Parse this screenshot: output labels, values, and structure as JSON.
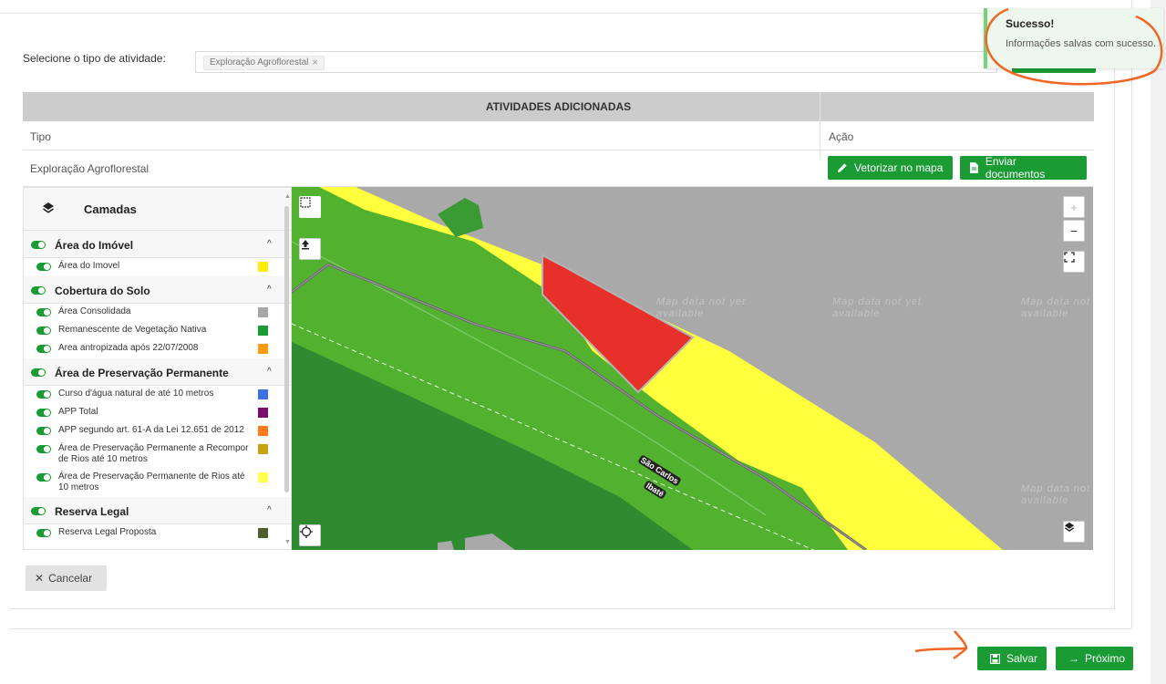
{
  "activity": {
    "label": "Selecione o tipo de atividade:",
    "selected_chip": "Exploração Agroflorestal",
    "chip_remove": "×"
  },
  "toast": {
    "title": "Sucesso!",
    "message": "Informações salvas com sucesso."
  },
  "table": {
    "header": "ATIVIDADES ADICIONADAS",
    "columns": [
      "Tipo",
      "Ação"
    ],
    "rows": [
      {
        "tipo": "Exploração Agroflorestal",
        "vetorizar_label": "Vetorizar no mapa",
        "enviar_label": "Enviar documentos"
      }
    ]
  },
  "layers": {
    "title": "Camadas",
    "groups": [
      {
        "label": "Área do Imóvel",
        "items": [
          {
            "label": "Área do Imovel",
            "color": "#ffeb0a"
          }
        ]
      },
      {
        "label": "Cobertura do Solo",
        "items": [
          {
            "label": "Área Consolidada",
            "color": "#a6a6a6"
          },
          {
            "label": "Remanescente de Vegetação Nativa",
            "color": "#1a9b34"
          },
          {
            "label": "Area antropizada após 22/07/2008",
            "color": "#ff9a0d"
          }
        ]
      },
      {
        "label": "Área de Preservação Permanente",
        "items": [
          {
            "label": "Curso d'água natural de até 10 metros",
            "color": "#3d6fe6"
          },
          {
            "label": "APP Total",
            "color": "#7a0a6b"
          },
          {
            "label": "APP segundo art. 61-A da Lei 12.651 de 2012",
            "color": "#ff7a1a"
          },
          {
            "label": "Área de Preservação Permanente a Recompor de Rios até 10 metros",
            "color": "#c9a20f"
          },
          {
            "label": "Área de Preservação Permanente de Rios até 10 metros",
            "color": "#ffff4d"
          }
        ]
      },
      {
        "label": "Reserva Legal",
        "items": [
          {
            "label": "Reserva Legal Proposta",
            "color": "#4f5e2c"
          }
        ]
      }
    ]
  },
  "map": {
    "nodata_text": "Map data not yet available",
    "road_labels": [
      "São Carlos",
      "Ibaté"
    ],
    "zoom_in": "+",
    "zoom_out": "−"
  },
  "buttons": {
    "cancel": "Cancelar",
    "save": "Salvar",
    "next": "Próximo"
  }
}
